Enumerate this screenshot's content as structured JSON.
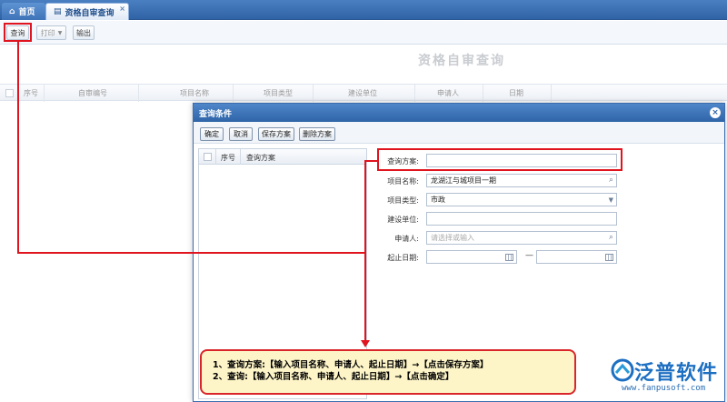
{
  "tabs": {
    "home": "首页",
    "active": "资格自审查询",
    "close": "×"
  },
  "toolbar": {
    "query": "查询",
    "print": "打印",
    "export": "输出"
  },
  "page": {
    "title": "资格自审查询"
  },
  "grid": {
    "columns": [
      "序号",
      "自审编号",
      "项目名称",
      "项目类型",
      "建设单位",
      "申请人",
      "日期"
    ]
  },
  "dialog": {
    "title": "查询条件",
    "close": "×",
    "buttons": {
      "confirm": "确定",
      "cancel": "取消",
      "save_scheme": "保存方案",
      "delete_scheme": "删除方案"
    },
    "list_columns": {
      "index": "序号",
      "scheme": "查询方案"
    },
    "form": {
      "scheme_label": "查询方案:",
      "scheme_value": "",
      "project_label": "项目名称:",
      "project_value": "龙湖江与城项目一期",
      "type_label": "项目类型:",
      "type_value": "市政",
      "unit_label": "建设单位:",
      "unit_value": "",
      "applicant_label": "申请人:",
      "applicant_placeholder": "请选择或输入",
      "date_label": "起止日期:",
      "date_separator": "—"
    }
  },
  "annotation": {
    "line1": "1、查询方案:【输入项目名称、申请人、起止日期】→【点击保存方案】",
    "line2": "2、查询:【输入项目名称、申请人、起止日期】→【点击确定】",
    "color": "#e0141e"
  },
  "brand": {
    "name": "泛普软件",
    "url": "www.fanpusoft.com"
  }
}
